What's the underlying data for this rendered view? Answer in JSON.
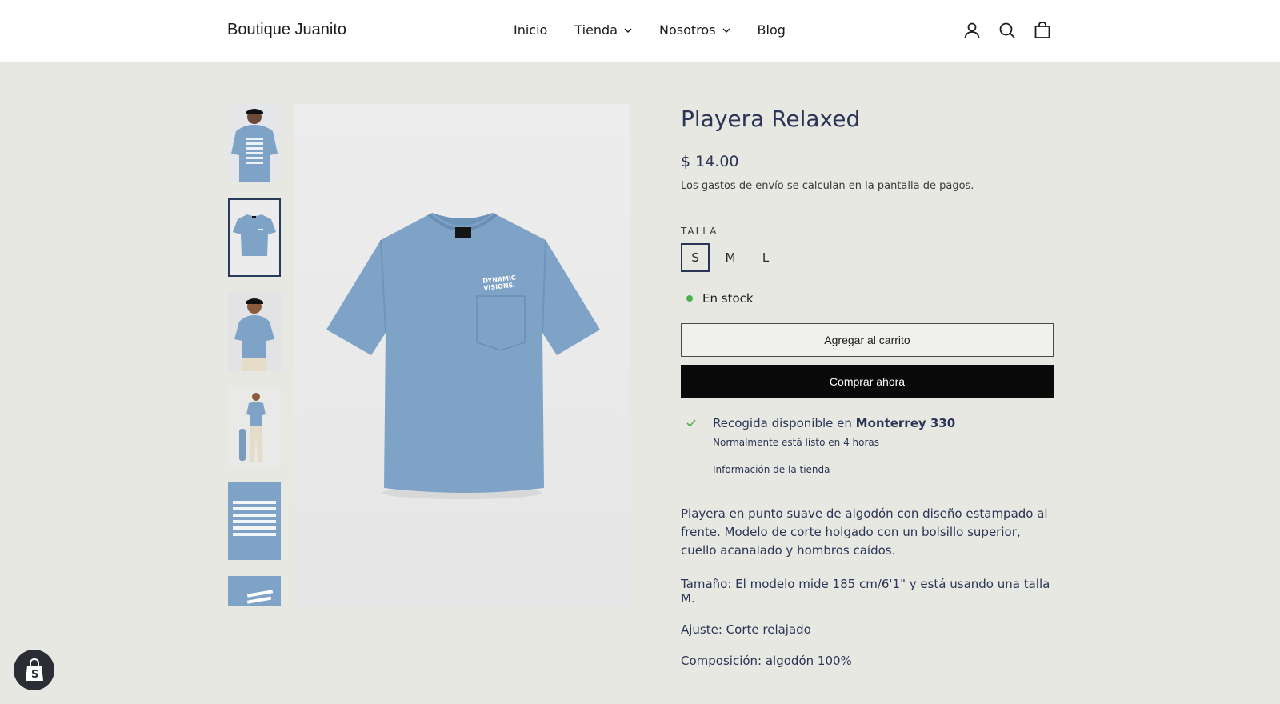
{
  "header": {
    "logo": "Boutique Juanito",
    "nav": [
      {
        "label": "Inicio",
        "dropdown": false
      },
      {
        "label": "Tienda",
        "dropdown": true
      },
      {
        "label": "Nosotros",
        "dropdown": true
      },
      {
        "label": "Blog",
        "dropdown": false
      }
    ],
    "icons": [
      "account-icon",
      "search-icon",
      "cart-icon"
    ]
  },
  "gallery": {
    "selected_index": 1,
    "thumbnail_count": 6
  },
  "product": {
    "title": "Playera Relaxed",
    "price": "$ 14.00",
    "shipping_prefix": "Los ",
    "shipping_link": "gastos de envío",
    "shipping_suffix": " se calculan en la pantalla de pagos.",
    "size_label": "TALLA",
    "sizes": [
      "S",
      "M",
      "L"
    ],
    "selected_size": "S",
    "stock": "En stock",
    "add_to_cart": "Agregar al carrito",
    "buy_now": "Comprar ahora",
    "pickup_prefix": "Recogida disponible en ",
    "pickup_location": "Monterrey 330",
    "pickup_time": "Normalmente está listo en 4 horas",
    "pickup_link": "Información de la tienda",
    "description": "Playera en punto suave de algodón con diseño estampado al frente. Modelo de corte holgado con un bolsillo superior, cuello acanalado y hombros caídos.",
    "size_detail": "Tamaño: El modelo mide 185 cm/6'1\" y está usando una talla M.",
    "fit": "Ajuste: Corte relajado",
    "composition": "Composición: algodón 100%",
    "print_text_1": "DYNAMIC",
    "print_text_2": "VISIONS."
  },
  "colors": {
    "header_bg": "#ffffff",
    "page_bg": "#e8e8e3",
    "title": "#2b3555",
    "shirt": "#7ea3c7",
    "stock_dot": "#4caf50",
    "buy_button": "#0a0a0a"
  }
}
